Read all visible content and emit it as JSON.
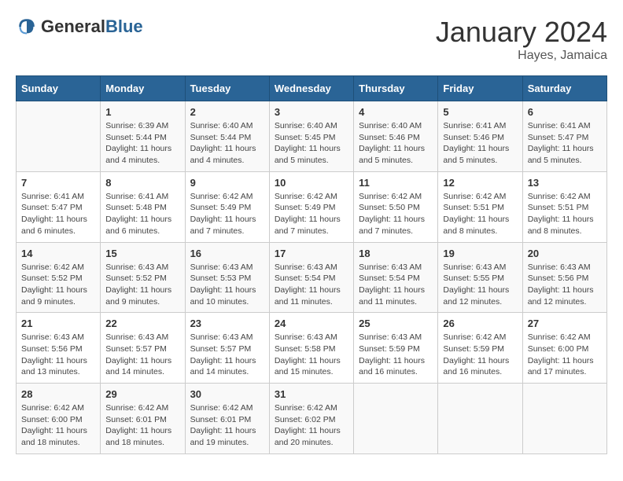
{
  "header": {
    "logo_general": "General",
    "logo_blue": "Blue",
    "month_title": "January 2024",
    "location": "Hayes, Jamaica"
  },
  "weekdays": [
    "Sunday",
    "Monday",
    "Tuesday",
    "Wednesday",
    "Thursday",
    "Friday",
    "Saturday"
  ],
  "weeks": [
    [
      {
        "day": "",
        "info": ""
      },
      {
        "day": "1",
        "info": "Sunrise: 6:39 AM\nSunset: 5:44 PM\nDaylight: 11 hours and 4 minutes."
      },
      {
        "day": "2",
        "info": "Sunrise: 6:40 AM\nSunset: 5:44 PM\nDaylight: 11 hours and 4 minutes."
      },
      {
        "day": "3",
        "info": "Sunrise: 6:40 AM\nSunset: 5:45 PM\nDaylight: 11 hours and 5 minutes."
      },
      {
        "day": "4",
        "info": "Sunrise: 6:40 AM\nSunset: 5:46 PM\nDaylight: 11 hours and 5 minutes."
      },
      {
        "day": "5",
        "info": "Sunrise: 6:41 AM\nSunset: 5:46 PM\nDaylight: 11 hours and 5 minutes."
      },
      {
        "day": "6",
        "info": "Sunrise: 6:41 AM\nSunset: 5:47 PM\nDaylight: 11 hours and 5 minutes."
      }
    ],
    [
      {
        "day": "7",
        "info": "Sunrise: 6:41 AM\nSunset: 5:47 PM\nDaylight: 11 hours and 6 minutes."
      },
      {
        "day": "8",
        "info": "Sunrise: 6:41 AM\nSunset: 5:48 PM\nDaylight: 11 hours and 6 minutes."
      },
      {
        "day": "9",
        "info": "Sunrise: 6:42 AM\nSunset: 5:49 PM\nDaylight: 11 hours and 7 minutes."
      },
      {
        "day": "10",
        "info": "Sunrise: 6:42 AM\nSunset: 5:49 PM\nDaylight: 11 hours and 7 minutes."
      },
      {
        "day": "11",
        "info": "Sunrise: 6:42 AM\nSunset: 5:50 PM\nDaylight: 11 hours and 7 minutes."
      },
      {
        "day": "12",
        "info": "Sunrise: 6:42 AM\nSunset: 5:51 PM\nDaylight: 11 hours and 8 minutes."
      },
      {
        "day": "13",
        "info": "Sunrise: 6:42 AM\nSunset: 5:51 PM\nDaylight: 11 hours and 8 minutes."
      }
    ],
    [
      {
        "day": "14",
        "info": "Sunrise: 6:42 AM\nSunset: 5:52 PM\nDaylight: 11 hours and 9 minutes."
      },
      {
        "day": "15",
        "info": "Sunrise: 6:43 AM\nSunset: 5:52 PM\nDaylight: 11 hours and 9 minutes."
      },
      {
        "day": "16",
        "info": "Sunrise: 6:43 AM\nSunset: 5:53 PM\nDaylight: 11 hours and 10 minutes."
      },
      {
        "day": "17",
        "info": "Sunrise: 6:43 AM\nSunset: 5:54 PM\nDaylight: 11 hours and 11 minutes."
      },
      {
        "day": "18",
        "info": "Sunrise: 6:43 AM\nSunset: 5:54 PM\nDaylight: 11 hours and 11 minutes."
      },
      {
        "day": "19",
        "info": "Sunrise: 6:43 AM\nSunset: 5:55 PM\nDaylight: 11 hours and 12 minutes."
      },
      {
        "day": "20",
        "info": "Sunrise: 6:43 AM\nSunset: 5:56 PM\nDaylight: 11 hours and 12 minutes."
      }
    ],
    [
      {
        "day": "21",
        "info": "Sunrise: 6:43 AM\nSunset: 5:56 PM\nDaylight: 11 hours and 13 minutes."
      },
      {
        "day": "22",
        "info": "Sunrise: 6:43 AM\nSunset: 5:57 PM\nDaylight: 11 hours and 14 minutes."
      },
      {
        "day": "23",
        "info": "Sunrise: 6:43 AM\nSunset: 5:57 PM\nDaylight: 11 hours and 14 minutes."
      },
      {
        "day": "24",
        "info": "Sunrise: 6:43 AM\nSunset: 5:58 PM\nDaylight: 11 hours and 15 minutes."
      },
      {
        "day": "25",
        "info": "Sunrise: 6:43 AM\nSunset: 5:59 PM\nDaylight: 11 hours and 16 minutes."
      },
      {
        "day": "26",
        "info": "Sunrise: 6:42 AM\nSunset: 5:59 PM\nDaylight: 11 hours and 16 minutes."
      },
      {
        "day": "27",
        "info": "Sunrise: 6:42 AM\nSunset: 6:00 PM\nDaylight: 11 hours and 17 minutes."
      }
    ],
    [
      {
        "day": "28",
        "info": "Sunrise: 6:42 AM\nSunset: 6:00 PM\nDaylight: 11 hours and 18 minutes."
      },
      {
        "day": "29",
        "info": "Sunrise: 6:42 AM\nSunset: 6:01 PM\nDaylight: 11 hours and 18 minutes."
      },
      {
        "day": "30",
        "info": "Sunrise: 6:42 AM\nSunset: 6:01 PM\nDaylight: 11 hours and 19 minutes."
      },
      {
        "day": "31",
        "info": "Sunrise: 6:42 AM\nSunset: 6:02 PM\nDaylight: 11 hours and 20 minutes."
      },
      {
        "day": "",
        "info": ""
      },
      {
        "day": "",
        "info": ""
      },
      {
        "day": "",
        "info": ""
      }
    ]
  ]
}
